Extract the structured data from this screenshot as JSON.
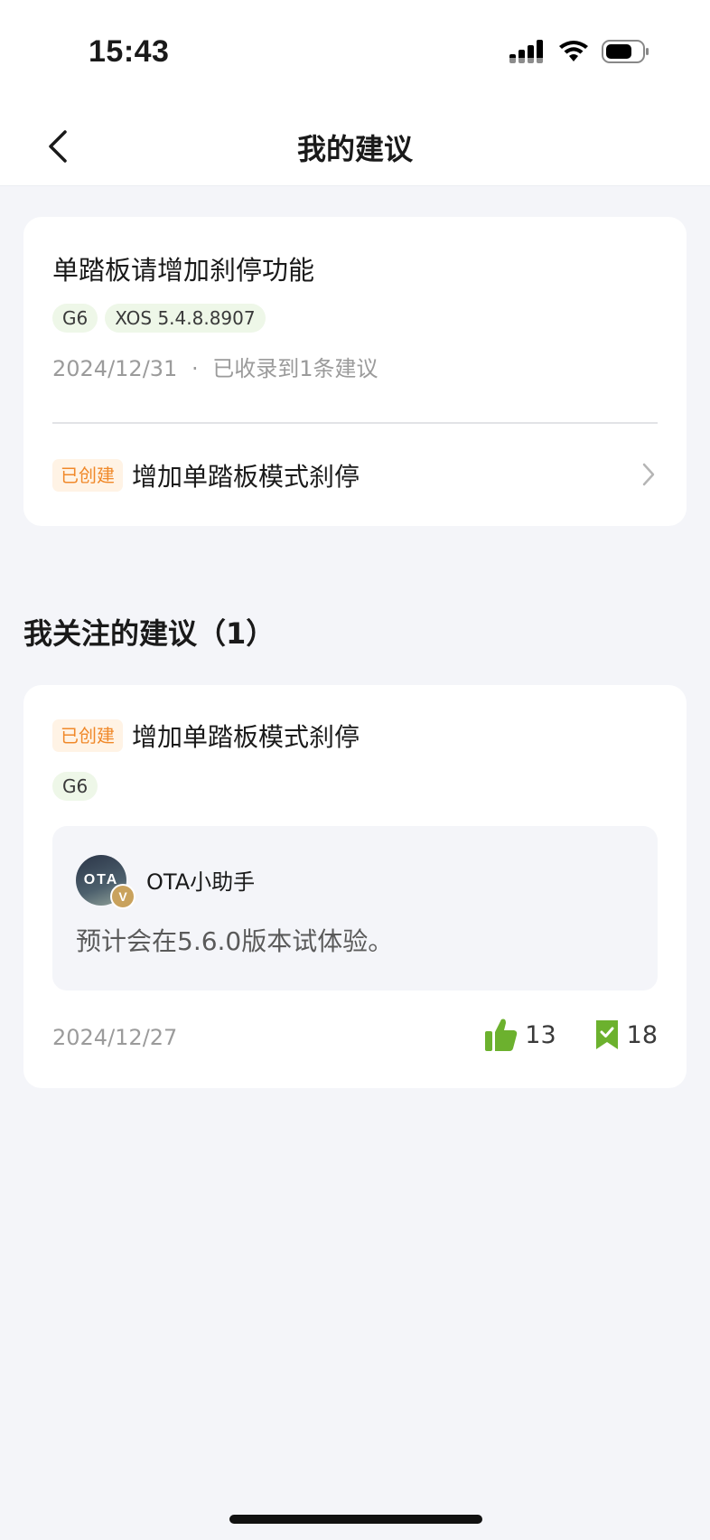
{
  "status_bar": {
    "time": "15:43"
  },
  "nav": {
    "title": "我的建议"
  },
  "my_suggestion": {
    "title": "单踏板请增加刹停功能",
    "tags": [
      "G6",
      "XOS 5.4.8.8907"
    ],
    "date": "2024/12/31",
    "separator": "·",
    "collected": "已收录到1条建议",
    "status_badge": "已创建",
    "linked_title": "增加单踏板模式刹停"
  },
  "followed": {
    "section_title": "我关注的建议（1）",
    "items": [
      {
        "status_badge": "已创建",
        "title": "增加单踏板模式刹停",
        "tags": [
          "G6"
        ],
        "reply": {
          "avatar_text": "OTA",
          "verified_mark": "V",
          "author": "OTA小助手",
          "text": "预计会在5.6.0版本试体验。"
        },
        "date": "2024/12/27",
        "like_count": "13",
        "bookmark_count": "18"
      }
    ]
  },
  "colors": {
    "accent_green": "#6cb12e",
    "badge_orange": "#f0892a",
    "tag_bg": "#eef7e8",
    "page_bg": "#f4f5f9"
  },
  "icons": [
    "signal-icon",
    "wifi-icon",
    "battery-icon",
    "back-arrow-icon",
    "chevron-right-icon",
    "thumbs-up-icon",
    "bookmark-check-icon"
  ]
}
